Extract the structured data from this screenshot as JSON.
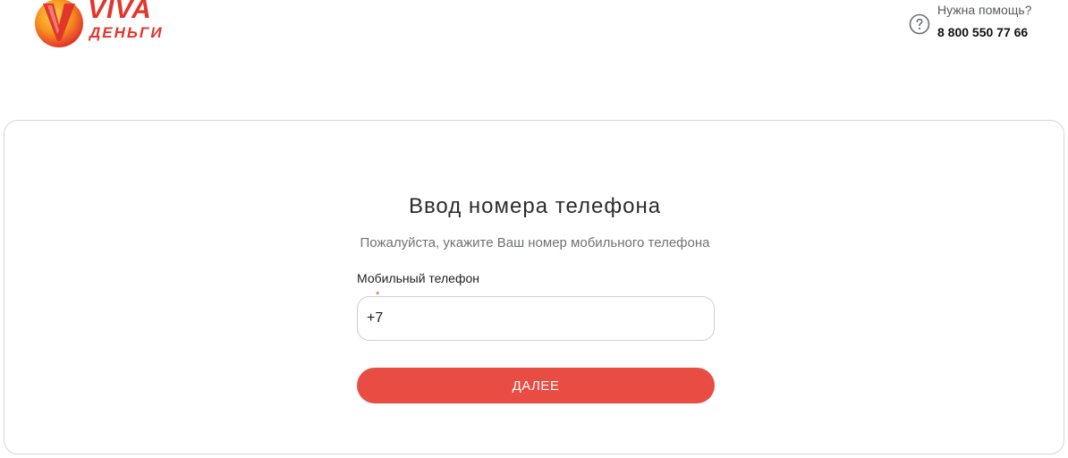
{
  "header": {
    "logo": {
      "word_top": "VIVA",
      "word_bottom": "ДЕНЬГИ",
      "icon": "viva-v-logo-icon"
    },
    "help": {
      "icon": "question-circle-icon",
      "text": "Нужна помощь?",
      "phone": "8 800 550 77 66"
    }
  },
  "form": {
    "title": "Ввод номера телефона",
    "subtitle": "Пожалуйста, укажите Ваш номер мобильного телефона",
    "phone_field": {
      "label": "Мобильный телефон",
      "required_mark": "*",
      "value": "+7"
    },
    "submit_label": "ДАЛЕЕ"
  },
  "colors": {
    "brand": "#e2362b",
    "button": "#e84c43",
    "logo_orange": "#f7931e"
  }
}
